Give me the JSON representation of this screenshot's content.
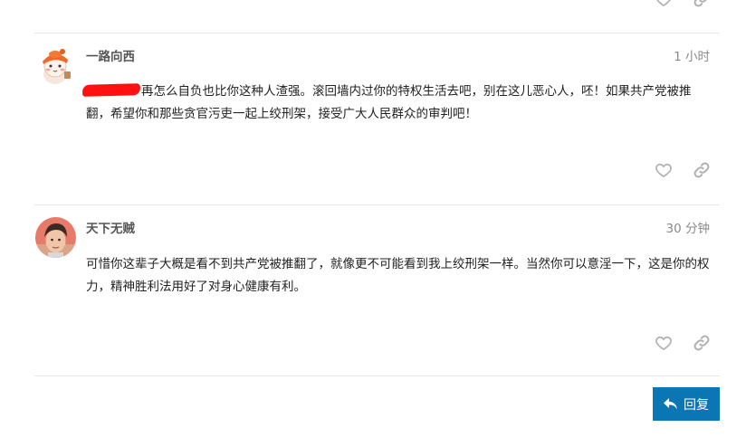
{
  "posts": [
    {
      "username": "一路向西",
      "time": "1 小时",
      "body_after_redaction": "再怎么自负也比你这种人渣强。滚回墙内过你的特权生活去吧，别在这儿恶心人，呸！如果共产党被推翻，希望你和那些贪官污吏一起上绞刑架，接受广大人民群众的审判吧！",
      "avatar_icon": "cartoon-character-avatar",
      "has_redaction": true
    },
    {
      "username": "天下无贼",
      "time": "30 分钟",
      "body": "可惜你这辈子大概是看不到共产党被推翻了，就像更不可能看到我上绞刑架一样。当然你可以意淫一下，这是你的权力，精神胜利法用好了对身心健康有利。",
      "avatar_icon": "person-photo-avatar"
    }
  ],
  "actions": {
    "like_icon": "heart-icon",
    "link_icon": "link-icon"
  },
  "reply_button": {
    "label": "回复",
    "icon": "reply-arrow-icon",
    "background": "#0a76b3"
  },
  "colors": {
    "redaction": "#ff1111",
    "icon_gray": "#b0b0b0"
  }
}
